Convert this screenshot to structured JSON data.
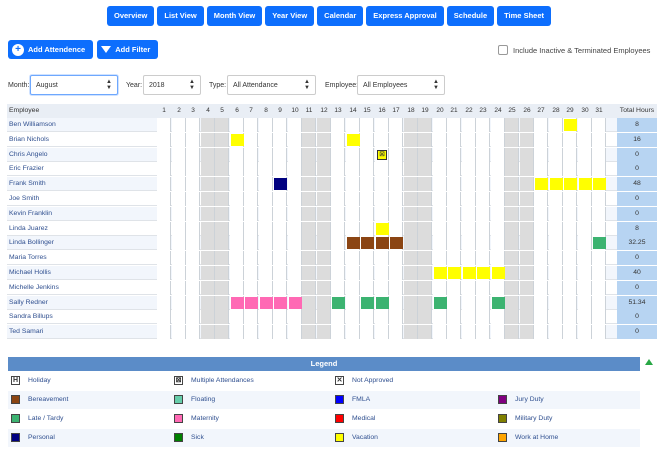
{
  "nav": [
    "Overview",
    "List View",
    "Month View",
    "Year View",
    "Calendar",
    "Express Approval",
    "Schedule",
    "Time Sheet"
  ],
  "actions": {
    "add_attendance": "Add Attendence",
    "add_filter": "Add Filter"
  },
  "include_inactive": "Include Inactive & Terminated Employees",
  "filters": {
    "month_label": "Month:",
    "month": "August",
    "year_label": "Year:",
    "year": "2018",
    "type_label": "Type:",
    "type": "All Attendance",
    "employee_label": "Employee:",
    "employee": "All Employees"
  },
  "grid": {
    "employee_header": "Employee",
    "total_header": "Total Hours",
    "days": [
      "1",
      "2",
      "3",
      "4",
      "5",
      "6",
      "7",
      "8",
      "9",
      "10",
      "11",
      "12",
      "13",
      "14",
      "15",
      "16",
      "17",
      "18",
      "19",
      "20",
      "21",
      "22",
      "23",
      "24",
      "25",
      "26",
      "27",
      "28",
      "29",
      "30",
      "31"
    ],
    "weekend_days": [
      4,
      5,
      11,
      12,
      18,
      19,
      25,
      26
    ],
    "employees": [
      {
        "name": "Ben Williamson",
        "total": "8",
        "marks": [
          {
            "day": 29,
            "type": "vacation"
          }
        ]
      },
      {
        "name": "Brian Nichols",
        "total": "16",
        "marks": [
          {
            "day": 6,
            "type": "vacation"
          },
          {
            "day": 14,
            "type": "vacation"
          }
        ]
      },
      {
        "name": "Chris Angelo",
        "total": "0",
        "marks": [
          {
            "day": 16,
            "type": "multiple"
          }
        ]
      },
      {
        "name": "Eric Frazier",
        "total": "0",
        "marks": []
      },
      {
        "name": "Frank Smith",
        "total": "48",
        "marks": [
          {
            "day": 9,
            "type": "personal"
          },
          {
            "day": 27,
            "type": "vacation"
          },
          {
            "day": 28,
            "type": "vacation"
          },
          {
            "day": 29,
            "type": "vacation"
          },
          {
            "day": 30,
            "type": "vacation"
          },
          {
            "day": 31,
            "type": "vacation"
          }
        ]
      },
      {
        "name": "Joe Smith",
        "total": "0",
        "marks": []
      },
      {
        "name": "Kevin Franklin",
        "total": "0",
        "marks": []
      },
      {
        "name": "Linda Juarez",
        "total": "8",
        "marks": [
          {
            "day": 16,
            "type": "vacation"
          }
        ]
      },
      {
        "name": "Linda Bollinger",
        "total": "32.25",
        "marks": [
          {
            "day": 14,
            "type": "bereavement"
          },
          {
            "day": 15,
            "type": "bereavement"
          },
          {
            "day": 16,
            "type": "bereavement"
          },
          {
            "day": 17,
            "type": "bereavement"
          },
          {
            "day": 31,
            "type": "late"
          }
        ]
      },
      {
        "name": "Maria Torres",
        "total": "0",
        "marks": []
      },
      {
        "name": "Michael Hollis",
        "total": "40",
        "marks": [
          {
            "day": 20,
            "type": "vacation"
          },
          {
            "day": 21,
            "type": "vacation"
          },
          {
            "day": 22,
            "type": "vacation"
          },
          {
            "day": 23,
            "type": "vacation"
          },
          {
            "day": 24,
            "type": "vacation"
          }
        ]
      },
      {
        "name": "Michelle Jenkins",
        "total": "0",
        "marks": []
      },
      {
        "name": "Sally Redner",
        "total": "51.34",
        "marks": [
          {
            "day": 6,
            "type": "maternity"
          },
          {
            "day": 7,
            "type": "maternity"
          },
          {
            "day": 8,
            "type": "maternity"
          },
          {
            "day": 9,
            "type": "maternity"
          },
          {
            "day": 10,
            "type": "maternity"
          },
          {
            "day": 13,
            "type": "late"
          },
          {
            "day": 15,
            "type": "late"
          },
          {
            "day": 16,
            "type": "late"
          },
          {
            "day": 20,
            "type": "late"
          },
          {
            "day": 24,
            "type": "late"
          }
        ]
      },
      {
        "name": "Sandra Billups",
        "total": "0",
        "marks": []
      },
      {
        "name": "Ted Samari",
        "total": "0",
        "marks": []
      }
    ]
  },
  "colors": {
    "vacation": "#ffff00",
    "personal": "#000080",
    "bereavement": "#8b4513",
    "late": "#3cb371",
    "maternity": "#ff69b4",
    "floating": "#66cdaa",
    "fmla": "#0000ff",
    "jury": "#800080",
    "medical": "#ff0000",
    "military": "#808000",
    "sick": "#008000",
    "work_home": "#ffa500"
  },
  "legend": {
    "title": "Legend",
    "items": [
      [
        {
          "label": "Holiday",
          "glyph": "H"
        },
        {
          "label": "Multiple Attendances",
          "glyph": "⊠"
        },
        {
          "label": "Not Approved",
          "glyph": "✕"
        }
      ],
      [
        {
          "label": "Bereavement",
          "key": "bereavement"
        },
        {
          "label": "Floating",
          "key": "floating"
        },
        {
          "label": "FMLA",
          "key": "fmla"
        },
        {
          "label": "Jury Duty",
          "key": "jury"
        }
      ],
      [
        {
          "label": "Late / Tardy",
          "key": "late"
        },
        {
          "label": "Maternity",
          "key": "maternity"
        },
        {
          "label": "Medical",
          "key": "medical"
        },
        {
          "label": "Military Duty",
          "key": "military"
        }
      ],
      [
        {
          "label": "Personal",
          "key": "personal"
        },
        {
          "label": "Sick",
          "key": "sick"
        },
        {
          "label": "Vacation",
          "key": "vacation"
        },
        {
          "label": "Work at Home",
          "key": "work_home"
        }
      ]
    ]
  }
}
